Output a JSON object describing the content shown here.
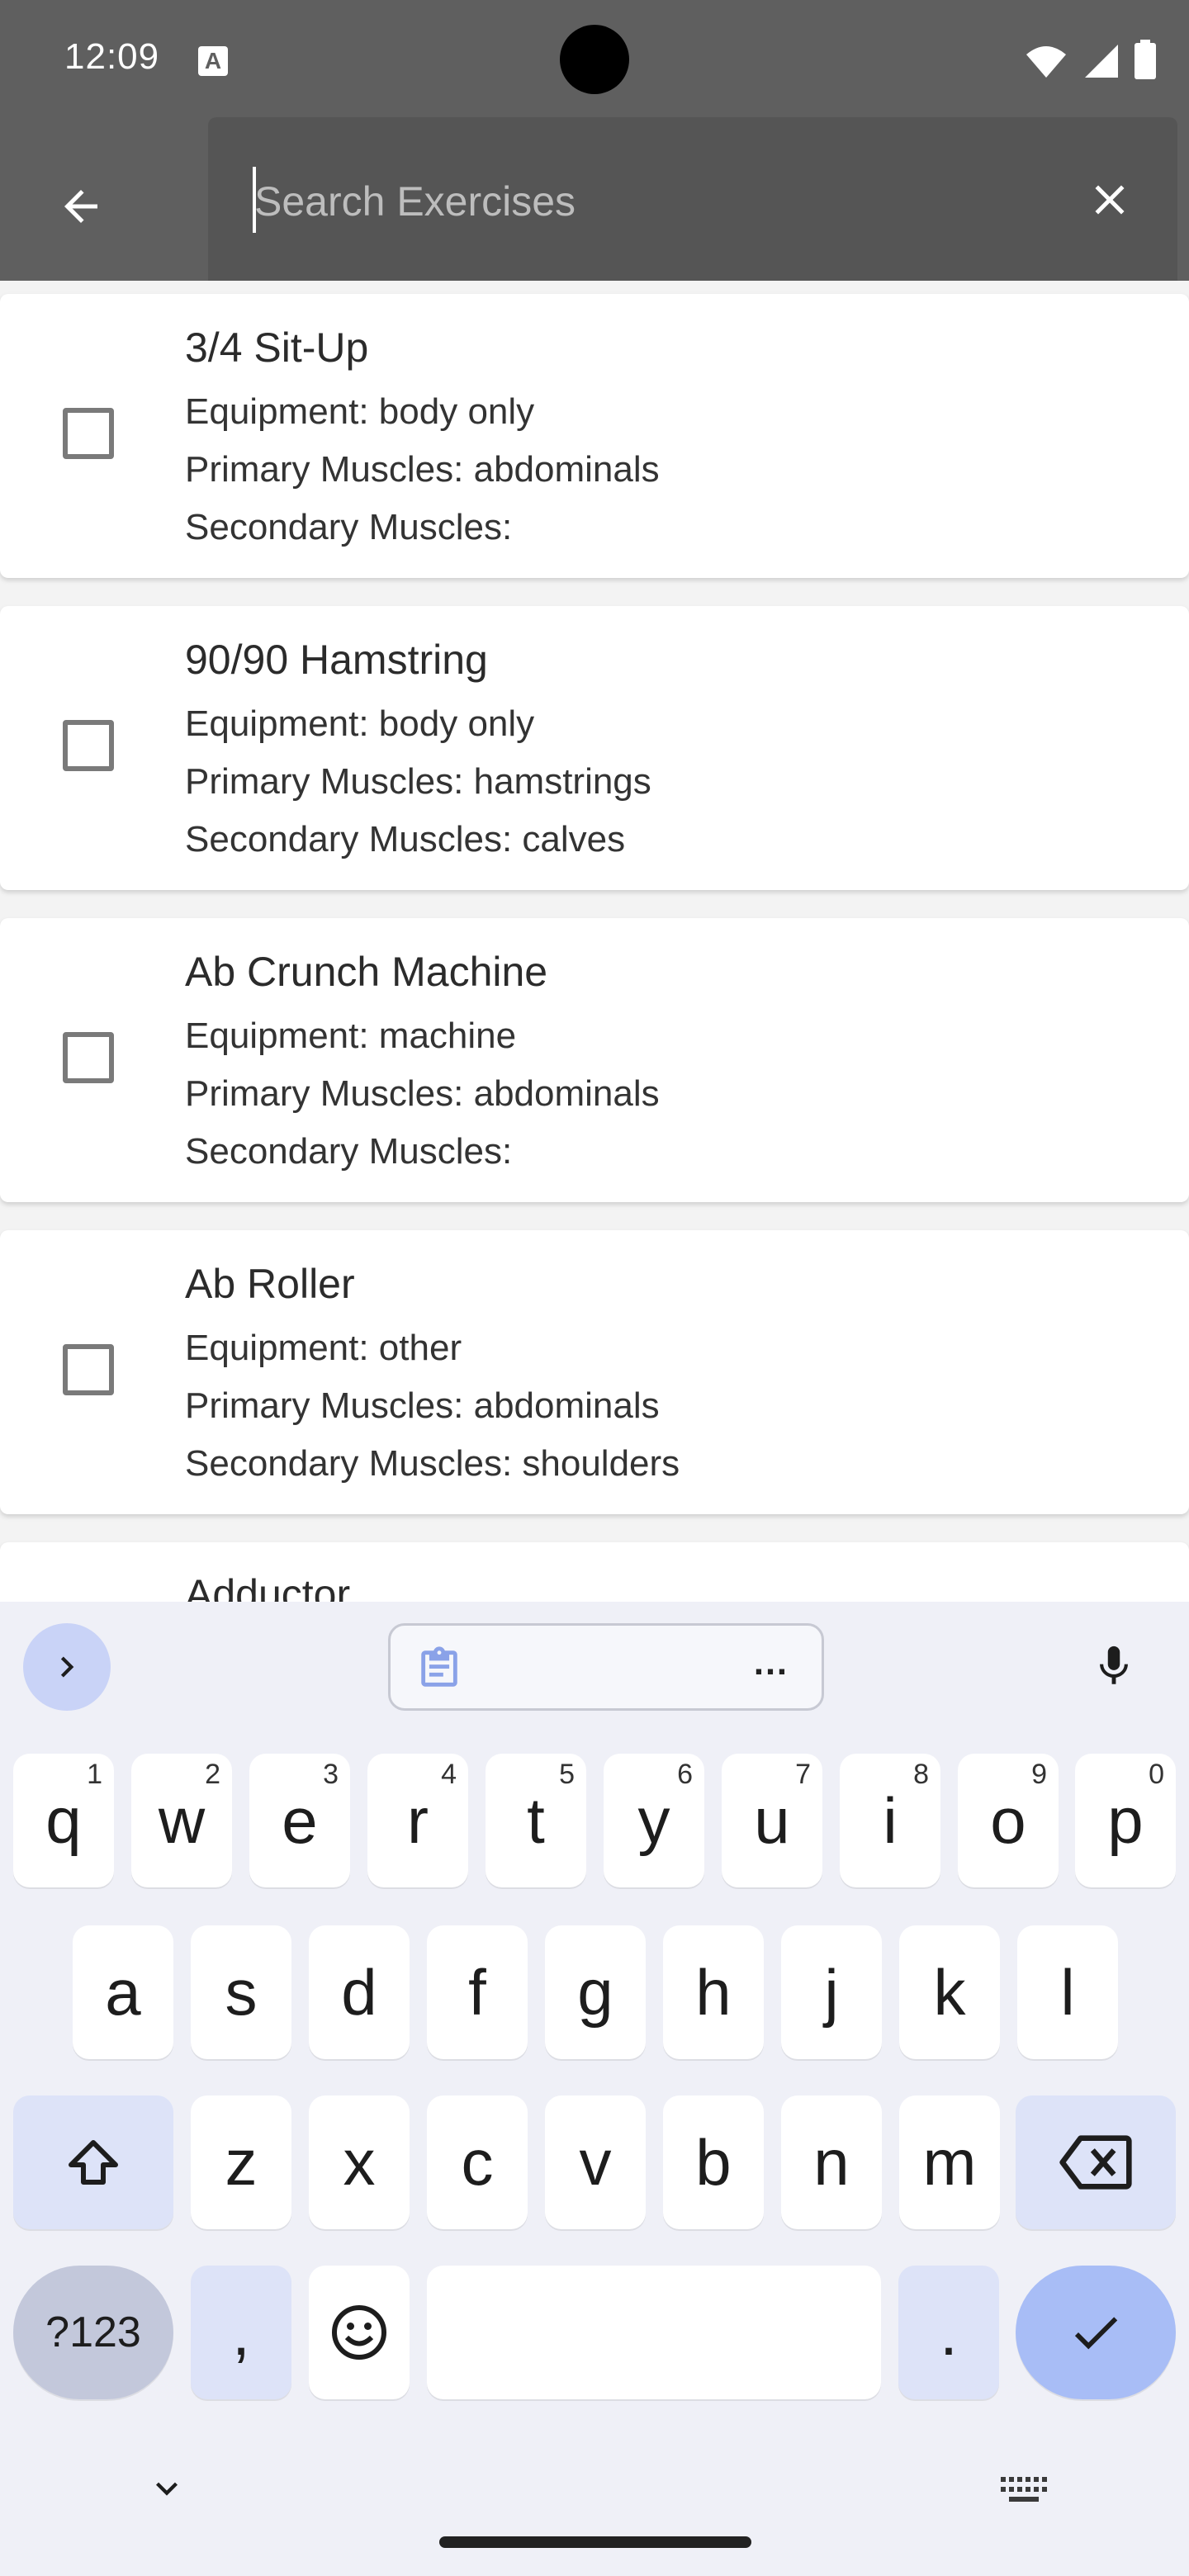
{
  "status_bar": {
    "time": "12:09",
    "notification_icon": "a-letter-icon",
    "wifi_icon": "wifi-icon",
    "signal_icon": "signal-icon",
    "battery_icon": "battery-icon"
  },
  "app_bar": {
    "back_icon": "arrow-back-icon",
    "search_placeholder": "Search Exercises",
    "search_value": "",
    "clear_icon": "close-icon"
  },
  "exercises": [
    {
      "name": "3/4 Sit-Up",
      "equipment": "Equipment: body only",
      "primary": "Primary Muscles: abdominals",
      "secondary": "Secondary Muscles:"
    },
    {
      "name": "90/90 Hamstring",
      "equipment": "Equipment: body only",
      "primary": "Primary Muscles: hamstrings",
      "secondary": "Secondary Muscles: calves"
    },
    {
      "name": "Ab Crunch Machine",
      "equipment": "Equipment: machine",
      "primary": "Primary Muscles: abdominals",
      "secondary": "Secondary Muscles:"
    },
    {
      "name": "Ab Roller",
      "equipment": "Equipment: other",
      "primary": "Primary Muscles: abdominals",
      "secondary": "Secondary Muscles: shoulders"
    },
    {
      "name": "Adductor",
      "equipment": "",
      "primary": "",
      "secondary": ""
    }
  ],
  "keyboard": {
    "clipboard_more": "…",
    "row1": [
      {
        "letter": "q",
        "hint": "1"
      },
      {
        "letter": "w",
        "hint": "2"
      },
      {
        "letter": "e",
        "hint": "3"
      },
      {
        "letter": "r",
        "hint": "4"
      },
      {
        "letter": "t",
        "hint": "5"
      },
      {
        "letter": "y",
        "hint": "6"
      },
      {
        "letter": "u",
        "hint": "7"
      },
      {
        "letter": "i",
        "hint": "8"
      },
      {
        "letter": "o",
        "hint": "9"
      },
      {
        "letter": "p",
        "hint": "0"
      }
    ],
    "row2": [
      "a",
      "s",
      "d",
      "f",
      "g",
      "h",
      "j",
      "k",
      "l"
    ],
    "row3": [
      "z",
      "x",
      "c",
      "v",
      "b",
      "n",
      "m"
    ],
    "symbols_label": "?123",
    "comma": ",",
    "period": "."
  },
  "colors": {
    "scrim": "#5f5f5f",
    "keyboard_bg": "#eff0f7",
    "enter_key": "#a8bdf6"
  }
}
